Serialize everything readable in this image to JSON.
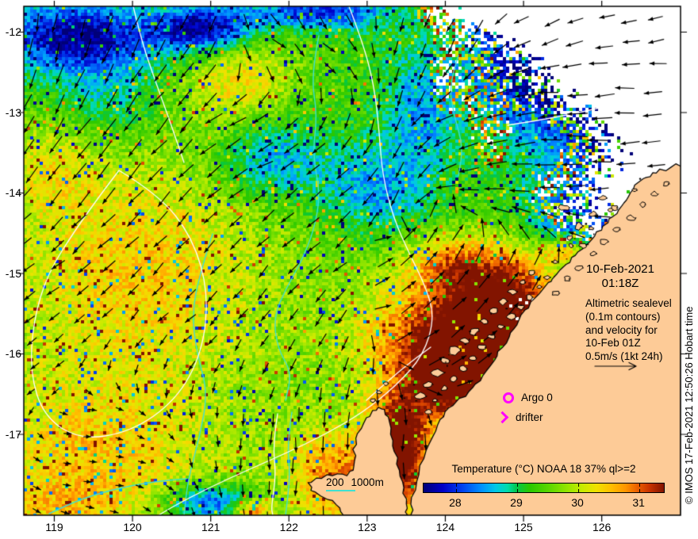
{
  "figure": {
    "credit": "© IMOS 17-Feb-2021 12:50:26 Hobart time",
    "timestamp": {
      "date": "10-Feb-2021",
      "time": "01:18Z"
    },
    "info_lines": [
      "Altimetric sealevel",
      "(0.1m contours)",
      "and velocity for",
      "10-Feb 01Z",
      "0.5m/s (1kt 24h)"
    ],
    "markers": {
      "argo_label": "Argo 0",
      "drifter_label": "drifter"
    },
    "bathy_legend": {
      "shallow": "200",
      "deep": "1000m"
    },
    "colorbar": {
      "title": "Temperature (°C) NOAA 18 37% ql>=2",
      "ticks": [
        28,
        29,
        30,
        31
      ],
      "range": {
        "min": 27.47,
        "max": 31.4
      },
      "gradient_stops": [
        [
          0,
          "#000078"
        ],
        [
          0.08,
          "#0000c8"
        ],
        [
          0.16,
          "#0040f0"
        ],
        [
          0.24,
          "#0090ff"
        ],
        [
          0.3,
          "#00c8e6"
        ],
        [
          0.35,
          "#00dcaa"
        ],
        [
          0.385,
          "#00c850"
        ],
        [
          0.44,
          "#28c800"
        ],
        [
          0.52,
          "#5ad700"
        ],
        [
          0.6,
          "#96e600"
        ],
        [
          0.66,
          "#c8eb00"
        ],
        [
          0.72,
          "#f0e100"
        ],
        [
          0.78,
          "#ffbe00"
        ],
        [
          0.84,
          "#ff9600"
        ],
        [
          0.89,
          "#eb5f00"
        ],
        [
          0.94,
          "#c83200"
        ],
        [
          1,
          "#821400"
        ]
      ]
    },
    "axes": {
      "lon_ticks": [
        "119",
        "120",
        "121",
        "122",
        "123",
        "124",
        "125",
        "126"
      ],
      "lat_ticks": [
        "-12",
        "-13",
        "-14",
        "-15",
        "-16",
        "-17"
      ]
    },
    "colors": {
      "land": "#fdcb97",
      "sealevel_contour": "#ffffff",
      "bathy_contour": "#3fe0d0",
      "velocity_arrows": "#000000",
      "marker_magenta": "#ff00ff",
      "frame": "#000000",
      "background": "#ffffff"
    }
  }
}
